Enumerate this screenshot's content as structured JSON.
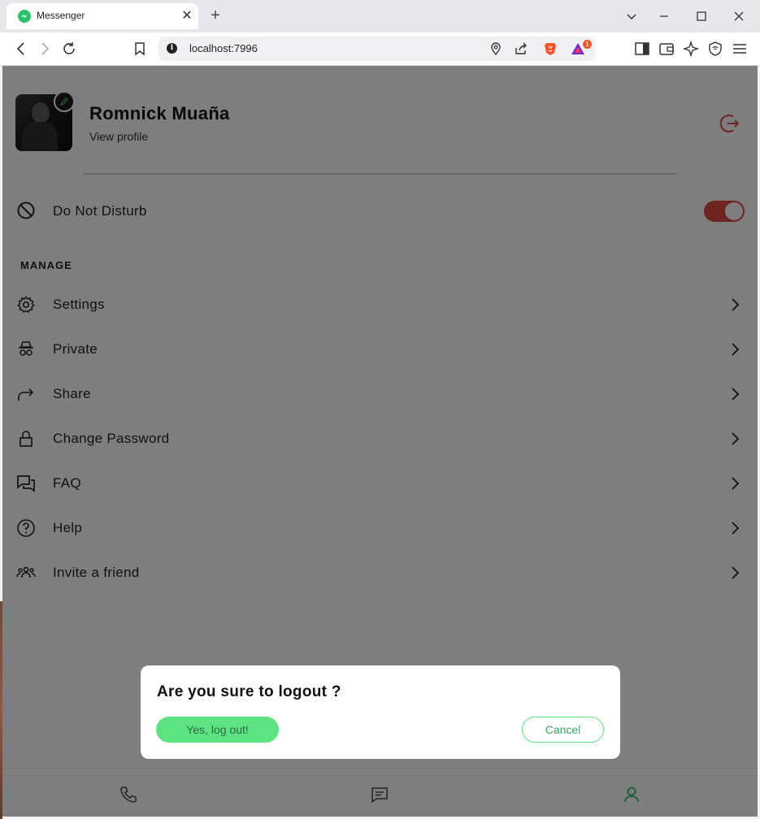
{
  "browser": {
    "tab_title": "Messenger",
    "url": "localhost:7996",
    "notification_count": "1",
    "brand_color": "#2bc36a"
  },
  "profile": {
    "name": "Romnick Muaña",
    "view_profile": "View profile"
  },
  "dnd": {
    "label": "Do Not Disturb",
    "enabled": true,
    "toggle_color": "#e04646"
  },
  "manage": {
    "heading": "MANAGE",
    "items": [
      {
        "label": "Settings",
        "icon": "gear-icon"
      },
      {
        "label": "Private",
        "icon": "incognito-icon"
      },
      {
        "label": "Share",
        "icon": "share-icon"
      },
      {
        "label": "Change Password",
        "icon": "lock-icon"
      },
      {
        "label": "FAQ",
        "icon": "chat-bubbles-icon"
      },
      {
        "label": "Help",
        "icon": "question-icon"
      },
      {
        "label": "Invite a friend",
        "icon": "group-icon"
      }
    ]
  },
  "bottom_nav": {
    "items": [
      "phone-icon",
      "message-icon",
      "user-icon"
    ],
    "active": "user-icon",
    "active_color": "#2bc36a"
  },
  "dialog": {
    "title": "Are you sure to logout ?",
    "confirm_label": "Yes, log out!",
    "cancel_label": "Cancel",
    "accent_color": "#5ee383"
  }
}
